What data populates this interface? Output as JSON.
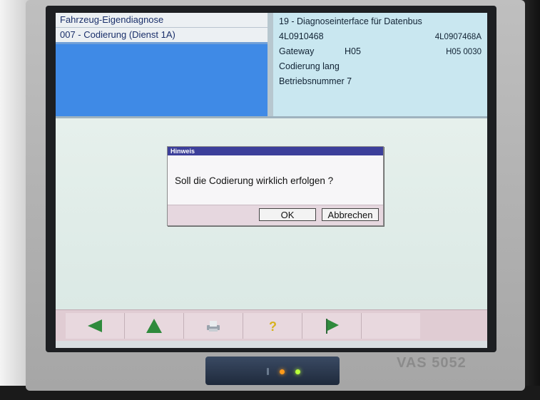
{
  "header": {
    "left_title": "Fahrzeug-Eigendiagnose",
    "left_subtitle": "007 - Codierung (Dienst 1A)",
    "right_title": "19 - Diagnoseinterface für Datenbus",
    "part_left": "4L0910468",
    "part_right": "4L0907468A",
    "gateway_label": "Gateway",
    "gateway_code": "H05",
    "gateway_version": "H05  0030",
    "coding": "Codierung lang",
    "operator": "Betriebsnummer 7"
  },
  "dialog": {
    "title": "Hinweis",
    "message": "Soll die Codierung wirklich erfolgen ?",
    "ok_label": "OK",
    "cancel_label": "Abbrechen"
  },
  "toolbar": {
    "icons": [
      "back-arrow-icon",
      "up-arrow-icon",
      "print-icon",
      "help-icon",
      "forward-flag-icon"
    ]
  },
  "colors": {
    "header_blue": "#3f8ae6",
    "header_info_bg": "#c9e7f0",
    "dialog_title_bar": "#3c3f9a",
    "toolbar_bg": "#e0ccd3",
    "arrow_green": "#2f8a3c",
    "led_orange": "#ff9a1a",
    "led_green": "#b8ff3a"
  },
  "device": {
    "model": "VAS 5052"
  }
}
